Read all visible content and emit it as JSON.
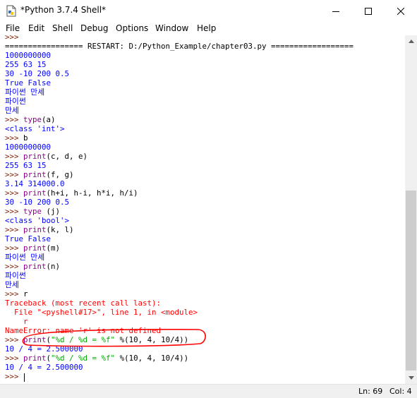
{
  "window": {
    "title": "*Python 3.7.4 Shell*",
    "controls": [
      "minimize",
      "maximize",
      "close"
    ]
  },
  "menu": [
    "File",
    "Edit",
    "Shell",
    "Debug",
    "Options",
    "Window",
    "Help"
  ],
  "shell": {
    "lines": [
      [
        {
          "t": ">>>",
          "c": "prompt"
        }
      ],
      [
        {
          "t": "================= RESTART: D:/Python_Example/chapter03.py ==================",
          "c": "restart"
        }
      ],
      [
        {
          "t": "1000000000",
          "c": "out"
        }
      ],
      [
        {
          "t": "255 63 15",
          "c": "out"
        }
      ],
      [
        {
          "t": "30 -10 200 0.5",
          "c": "out"
        }
      ],
      [
        {
          "t": "True False",
          "c": "out"
        }
      ],
      [
        {
          "t": "파이썬 만세",
          "c": "out"
        }
      ],
      [
        {
          "t": "파이썬",
          "c": "out"
        }
      ],
      [
        {
          "t": "만세",
          "c": "out"
        }
      ],
      [
        {
          "t": ">>> ",
          "c": "prompt"
        },
        {
          "t": "type",
          "c": "builtin"
        },
        {
          "t": "(a)",
          "c": "in"
        }
      ],
      [
        {
          "t": "<class 'int'>",
          "c": "out"
        }
      ],
      [
        {
          "t": ">>> ",
          "c": "prompt"
        },
        {
          "t": "b",
          "c": "in"
        }
      ],
      [
        {
          "t": "1000000000",
          "c": "out"
        }
      ],
      [
        {
          "t": ">>> ",
          "c": "prompt"
        },
        {
          "t": "print",
          "c": "builtin"
        },
        {
          "t": "(c, d, e)",
          "c": "in"
        }
      ],
      [
        {
          "t": "255 63 15",
          "c": "out"
        }
      ],
      [
        {
          "t": ">>> ",
          "c": "prompt"
        },
        {
          "t": "print",
          "c": "builtin"
        },
        {
          "t": "(f, g)",
          "c": "in"
        }
      ],
      [
        {
          "t": "3.14 314000.0",
          "c": "out"
        }
      ],
      [
        {
          "t": ">>> ",
          "c": "prompt"
        },
        {
          "t": "print",
          "c": "builtin"
        },
        {
          "t": "(h+i, h-i, h*i, h/i)",
          "c": "in"
        }
      ],
      [
        {
          "t": "30 -10 200 0.5",
          "c": "out"
        }
      ],
      [
        {
          "t": ">>> ",
          "c": "prompt"
        },
        {
          "t": "type",
          "c": "builtin"
        },
        {
          "t": " (j)",
          "c": "in"
        }
      ],
      [
        {
          "t": "<class 'bool'>",
          "c": "out"
        }
      ],
      [
        {
          "t": ">>> ",
          "c": "prompt"
        },
        {
          "t": "print",
          "c": "builtin"
        },
        {
          "t": "(k, l)",
          "c": "in"
        }
      ],
      [
        {
          "t": "True False",
          "c": "out"
        }
      ],
      [
        {
          "t": ">>> ",
          "c": "prompt"
        },
        {
          "t": "print",
          "c": "builtin"
        },
        {
          "t": "(m)",
          "c": "in"
        }
      ],
      [
        {
          "t": "파이썬 만세",
          "c": "out"
        }
      ],
      [
        {
          "t": ">>> ",
          "c": "prompt"
        },
        {
          "t": "print",
          "c": "builtin"
        },
        {
          "t": "(n)",
          "c": "in"
        }
      ],
      [
        {
          "t": "파이썬",
          "c": "out"
        }
      ],
      [
        {
          "t": "만세",
          "c": "out"
        }
      ],
      [
        {
          "t": ">>> ",
          "c": "prompt"
        },
        {
          "t": "r",
          "c": "in"
        }
      ],
      [
        {
          "t": "Traceback (most recent call last):",
          "c": "err"
        }
      ],
      [
        {
          "t": "  File \"<pyshell#17>\", line 1, in <module>",
          "c": "err"
        }
      ],
      [
        {
          "t": "    r",
          "c": "err"
        }
      ],
      [
        {
          "t": "NameError: name 'r' is not defined",
          "c": "err"
        }
      ],
      [
        {
          "t": ">>> ",
          "c": "prompt"
        },
        {
          "t": "print",
          "c": "builtin"
        },
        {
          "t": "(",
          "c": "in"
        },
        {
          "t": "\"%d / %d = %f\"",
          "c": "str"
        },
        {
          "t": " %(10, 4, 10/4))",
          "c": "in"
        }
      ],
      [
        {
          "t": "10 / 4 = 2.500000",
          "c": "out"
        }
      ],
      [
        {
          "t": ">>> ",
          "c": "prompt"
        },
        {
          "t": "print",
          "c": "builtin"
        },
        {
          "t": "(",
          "c": "in"
        },
        {
          "t": "\"%d / %d = %f\"",
          "c": "str"
        },
        {
          "t": " %(10, 4, 10/4))",
          "c": "in"
        }
      ],
      [
        {
          "t": "10 / 4 = 2.500000",
          "c": "out"
        }
      ],
      [
        {
          "t": ">>> ",
          "c": "prompt"
        }
      ]
    ]
  },
  "status": {
    "line": "Ln: 69",
    "col": "Col: 4"
  },
  "colors": {
    "output": "#0000ff",
    "prompt": "#7f1f00",
    "builtin": "#900090",
    "string": "#00aa00",
    "error": "#ff0000",
    "annotation": "#ff0000"
  },
  "icons": {
    "app": "python-idle-icon",
    "minimize": "minimize-icon",
    "maximize": "maximize-icon",
    "close": "close-icon",
    "scroll_up": "scroll-up-arrow-icon",
    "scroll_down": "scroll-down-arrow-icon"
  }
}
